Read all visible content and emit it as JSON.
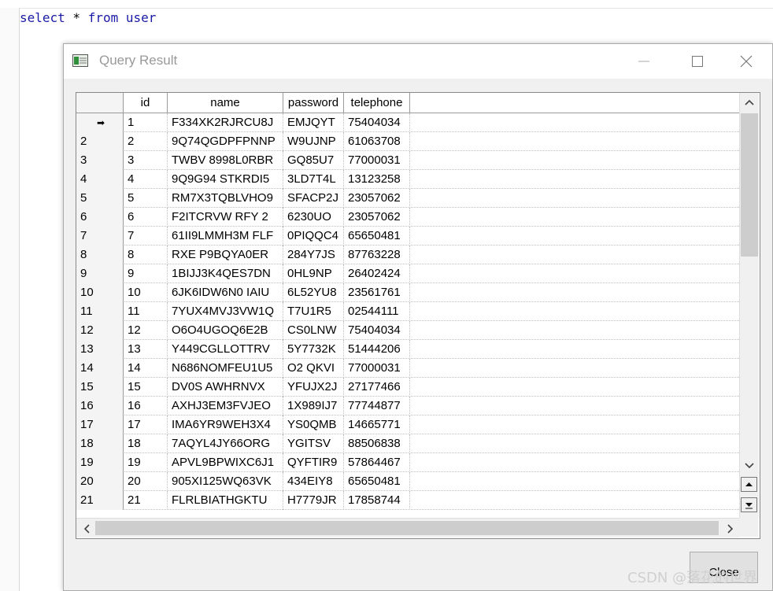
{
  "editor": {
    "code_kw1": "select",
    "code_mid": " * ",
    "code_kw2": "from",
    "code_sp": " ",
    "code_kw3": "user"
  },
  "dialog": {
    "title": "Query Result",
    "close_button": "Close"
  },
  "grid": {
    "columns": [
      "id",
      "name",
      "password",
      "telephone"
    ],
    "current_row_marker": "➡",
    "rows": [
      {
        "rownum": "",
        "id": "1",
        "name": "F334XK2RJRCU8J",
        "password": "EMJQYT",
        "telephone": "75404034"
      },
      {
        "rownum": "2",
        "id": "2",
        "name": "9Q74QGDPFPNNP",
        "password": "W9UJNP",
        "telephone": "61063708"
      },
      {
        "rownum": "3",
        "id": "3",
        "name": "TWBV 8998L0RBR",
        "password": "GQ85U7",
        "telephone": "77000031"
      },
      {
        "rownum": "4",
        "id": "4",
        "name": " 9Q9G94 STKRDI5",
        "password": "3LD7T4L",
        "telephone": "13123258"
      },
      {
        "rownum": "5",
        "id": "5",
        "name": "RM7X3TQBLVHO9",
        "password": "SFACP2J",
        "telephone": "23057062"
      },
      {
        "rownum": "6",
        "id": "6",
        "name": "F2ITCRVW RFY 2",
        "password": "6230UO",
        "telephone": "23057062"
      },
      {
        "rownum": "7",
        "id": "7",
        "name": "61II9LMMH3M FLF",
        "password": "0PIQQC4",
        "telephone": "65650481"
      },
      {
        "rownum": "8",
        "id": "8",
        "name": "RXE P9BQYA0ER",
        "password": "284Y7JS",
        "telephone": "87763228"
      },
      {
        "rownum": "9",
        "id": "9",
        "name": "1BIJJ3K4QES7DN",
        "password": "0HL9NP",
        "telephone": "26402424"
      },
      {
        "rownum": "10",
        "id": "10",
        "name": "6JK6IDW6N0 IAIU",
        "password": "6L52YU8",
        "telephone": "23561761"
      },
      {
        "rownum": "11",
        "id": "11",
        "name": "7YUX4MVJ3VW1Q",
        "password": "T7U1R5",
        "telephone": "02544111"
      },
      {
        "rownum": "12",
        "id": "12",
        "name": "O6O4UGOQ6E2B",
        "password": "CS0LNW",
        "telephone": "75404034"
      },
      {
        "rownum": "13",
        "id": "13",
        "name": "Y449CGLLOTTRV",
        "password": "5Y7732K",
        "telephone": "51444206"
      },
      {
        "rownum": "14",
        "id": "14",
        "name": "N686NOMFEU1U5",
        "password": "O2 QKVI",
        "telephone": "77000031"
      },
      {
        "rownum": "15",
        "id": "15",
        "name": "DV0S AWHRNVX",
        "password": "YFUJX2J",
        "telephone": "27177466"
      },
      {
        "rownum": "16",
        "id": "16",
        "name": "AXHJ3EM3FVJEO",
        "password": "1X989IJ7",
        "telephone": "77744877"
      },
      {
        "rownum": "17",
        "id": "17",
        "name": "IMA6YR9WEH3X4",
        "password": "YS0QMB",
        "telephone": "14665771"
      },
      {
        "rownum": "18",
        "id": "18",
        "name": "7AQYL4JY66ORG",
        "password": "YGITSV",
        "telephone": "88506838"
      },
      {
        "rownum": "19",
        "id": "19",
        "name": "APVL9BPWIXC6J1",
        "password": "QYFTIR9",
        "telephone": "57864467"
      },
      {
        "rownum": "20",
        "id": "20",
        "name": "905XI125WQ63VK",
        "password": " 434EIY8",
        "telephone": "65650481"
      },
      {
        "rownum": "21",
        "id": "21",
        "name": "FLRLBIATHGKTU",
        "password": "H7779JR",
        "telephone": "17858744"
      }
    ]
  },
  "watermark": "CSDN @落花的世界"
}
